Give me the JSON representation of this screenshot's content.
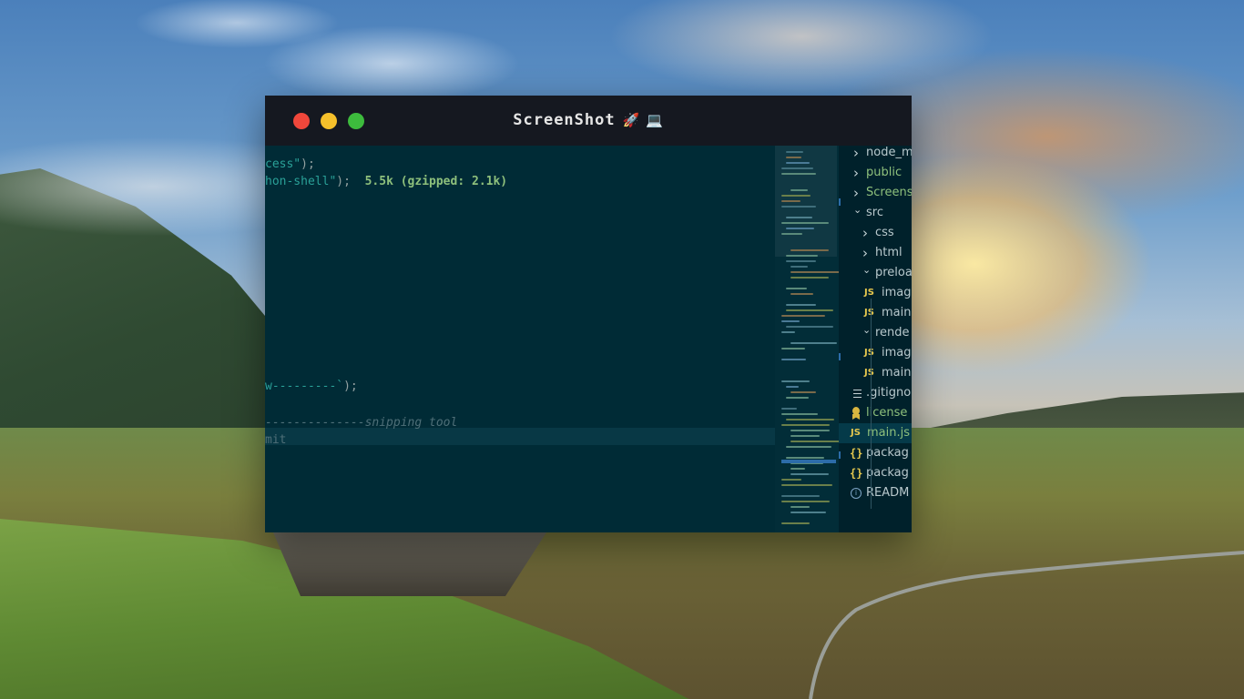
{
  "window": {
    "title": "ScreenShot",
    "title_emoji": "🚀 💻",
    "traffic_lights": {
      "close": "#f0473b",
      "minimize": "#f6c02b",
      "maximize": "#3dbb3d"
    }
  },
  "editor": {
    "lines": [
      {
        "segments": [
          {
            "text": "cess\"",
            "color": "#2aa198"
          },
          {
            "text": ");",
            "color": "#93a1a1"
          }
        ]
      },
      {
        "segments": [
          {
            "text": "hon-shell\"",
            "color": "#2aa198"
          },
          {
            "text": ");",
            "color": "#93a1a1"
          },
          {
            "text": "  5.5k (gzipped: 2.1k)",
            "color": "#8ec07c",
            "bold": true
          }
        ]
      },
      {
        "segments": [
          {
            "text": "w---------`",
            "color": "#2aa198"
          },
          {
            "text": ");",
            "color": "#93a1a1"
          }
        ]
      },
      {
        "segments": [
          {
            "text": "--------------snipping tool",
            "color": "#4f6f78",
            "italic": true
          }
        ]
      },
      {
        "segments": [
          {
            "text": "mit",
            "color": "#4f6f78"
          }
        ]
      }
    ]
  },
  "explorer": {
    "items": [
      {
        "label": "node_m",
        "type": "folder",
        "expanded": false
      },
      {
        "label": "public",
        "type": "folder",
        "expanded": false,
        "color": "#8ec07c"
      },
      {
        "label": "Screens",
        "type": "folder",
        "expanded": false,
        "color": "#8ec07c"
      },
      {
        "label": "src",
        "type": "folder",
        "expanded": true
      },
      {
        "label": "css",
        "type": "folder",
        "expanded": false
      },
      {
        "label": "html",
        "type": "folder",
        "expanded": false
      },
      {
        "label": "preloa",
        "type": "folder",
        "expanded": true
      },
      {
        "label": "imag",
        "type": "js",
        "icon": "JS"
      },
      {
        "label": "main",
        "type": "js",
        "icon": "JS"
      },
      {
        "label": "rende",
        "type": "folder",
        "expanded": true
      },
      {
        "label": "imag",
        "type": "js",
        "icon": "JS"
      },
      {
        "label": "main",
        "type": "js",
        "icon": "JS"
      },
      {
        "label": ".gitigno",
        "type": "text"
      },
      {
        "label": "license",
        "type": "license",
        "color": "#8ec07c"
      },
      {
        "label": "main.js",
        "type": "js",
        "icon": "JS",
        "active": true,
        "color": "#8ec07c"
      },
      {
        "label": "packag",
        "type": "json",
        "icon": "{}"
      },
      {
        "label": "packag",
        "type": "json",
        "icon": "{}"
      },
      {
        "label": "READM",
        "type": "info"
      }
    ]
  }
}
